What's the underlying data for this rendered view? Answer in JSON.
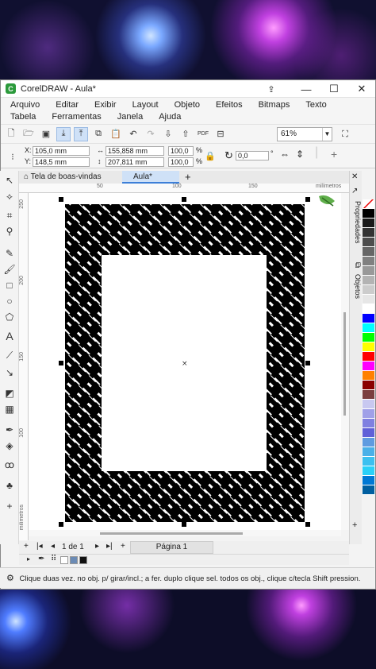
{
  "window": {
    "title": "CorelDRAW - Aula*",
    "minimize": "—",
    "maximize": "☐",
    "close": "✕"
  },
  "menu": [
    "Arquivo",
    "Editar",
    "Exibir",
    "Layout",
    "Objeto",
    "Efeitos",
    "Bitmaps",
    "Texto",
    "Tabela",
    "Ferramentas",
    "Janela",
    "Ajuda"
  ],
  "toolbar": {
    "zoom": "61%"
  },
  "property_bar": {
    "x_label": "X:",
    "x_value": "105,0 mm",
    "y_label": "Y:",
    "y_value": "148,5 mm",
    "width_value": "155,858 mm",
    "height_value": "207,811 mm",
    "scale_w": "100,0",
    "scale_h": "100,0",
    "pct": "%",
    "angle": "0,0",
    "degree": "°"
  },
  "tabs": {
    "welcome": "Tela de boas-vindas",
    "doc": "Aula*",
    "add": "+"
  },
  "rulers": {
    "h_ticks": [
      "50",
      "100",
      "150"
    ],
    "h_unit": "milímetros",
    "v_ticks": [
      "250",
      "200",
      "150",
      "100"
    ],
    "v_unit": "milímetros"
  },
  "dockers": {
    "properties": "Propriedades",
    "objects": "Objetos"
  },
  "page_nav": {
    "counter": "1 de 1",
    "page_tab": "Página 1"
  },
  "status": {
    "text": "Clique duas vez. no obj. p/ girar/incl.; a fer. duplo clique sel. todos os obj., clique c/tecla Shift pression."
  },
  "palette": [
    "#ffffff",
    "#000000",
    "#1a1a1a",
    "#333333",
    "#4d4d4d",
    "#666666",
    "#808080",
    "#999999",
    "#b3b3b3",
    "#cccccc",
    "#e6e6e6",
    "#ffffff",
    "#0000ff",
    "#00ffff",
    "#00ff00",
    "#ffff00",
    "#ff0000",
    "#ff00ff",
    "#ff8000",
    "#8b0000",
    "#7b3f3f",
    "#c8c8f0",
    "#a0a0e8",
    "#8080e0",
    "#6060d8",
    "#5f9be0",
    "#4ab0e8",
    "#3cc0f0",
    "#2ad0f8",
    "#0078d4",
    "#005fa0"
  ]
}
